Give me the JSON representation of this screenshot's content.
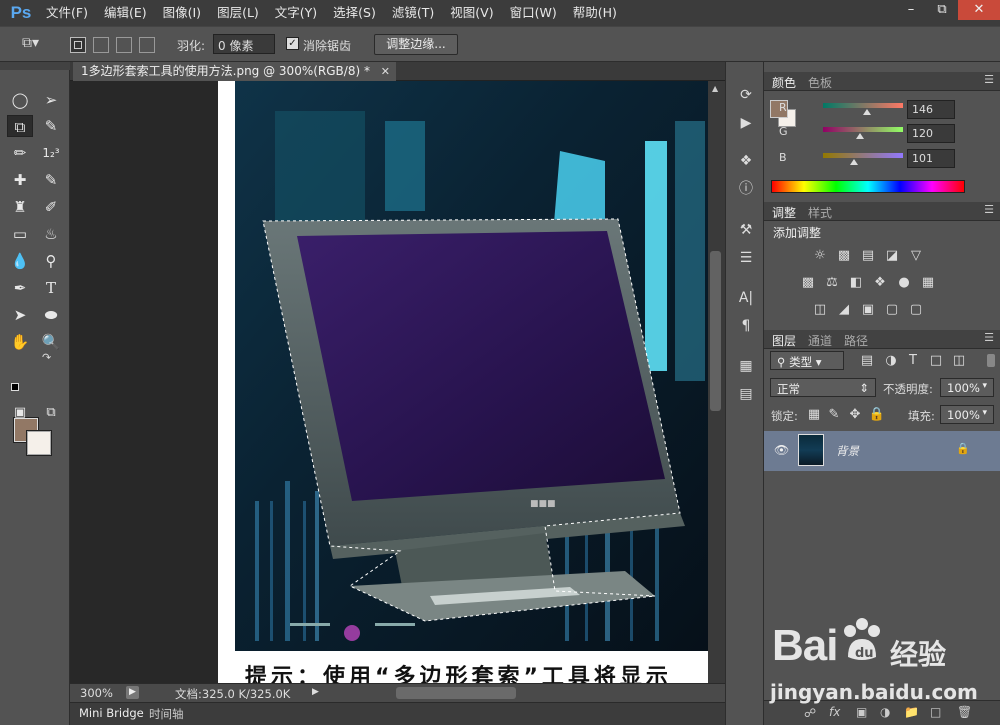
{
  "app": {
    "logo": "Ps",
    "menus": [
      "文件(F)",
      "编辑(E)",
      "图像(I)",
      "图层(L)",
      "文字(Y)",
      "选择(S)",
      "滤镜(T)",
      "视图(V)",
      "窗口(W)",
      "帮助(H)"
    ]
  },
  "options": {
    "feather_label": "羽化:",
    "feather_value": "0 像素",
    "antialias_label": "消除锯齿",
    "refine_edge": "调整边缘..."
  },
  "document": {
    "tab_title": "1多边形套索工具的使用方法.png @ 300%(RGB/8) *",
    "zoom": "300%",
    "doc_info": "文档:325.0 K/325.0K",
    "caption_text": "提示：使用“多边形套索”工具将显示"
  },
  "bottom_tabs": [
    "Mini Bridge",
    "时间轴"
  ],
  "color_panel": {
    "tabs": [
      "颜色",
      "色板"
    ],
    "r_label": "R",
    "r_value": "146",
    "g_label": "G",
    "g_value": "120",
    "b_label": "B",
    "b_value": "101",
    "foreground": "#927865",
    "background": "#f5f0ea"
  },
  "adjustments_panel": {
    "tabs": [
      "调整",
      "样式"
    ],
    "title": "添加调整"
  },
  "layers_panel": {
    "tabs": [
      "图层",
      "通道",
      "路径"
    ],
    "filter_kind": "类型",
    "blend_mode": "正常",
    "opacity_label": "不透明度:",
    "opacity_value": "100%",
    "lock_label": "锁定:",
    "fill_label": "填充:",
    "fill_value": "100%",
    "layer_name": "背景"
  },
  "watermark": {
    "brand": "Bai",
    "brand_cn": "经验",
    "url": "jingyan.baidu.com"
  }
}
